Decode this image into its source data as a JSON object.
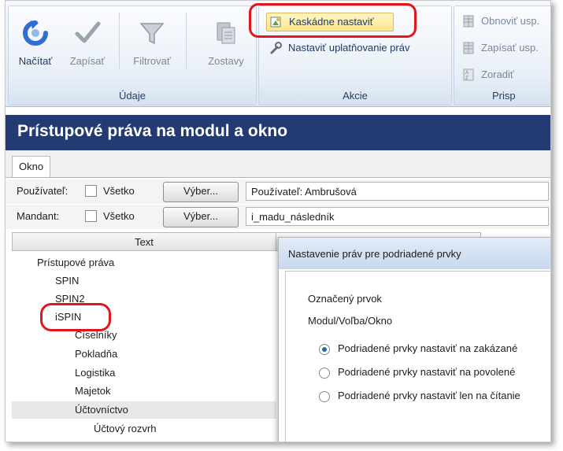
{
  "ribbon": {
    "data_group": {
      "label": "Údaje",
      "load": "Načítať",
      "save": "Zapísať",
      "filter": "Filtrovať",
      "reports": "Zostavy"
    },
    "actions_group": {
      "label": "Akcie",
      "cascade": "Kaskádne nastaviť",
      "apply_rights": "Nastaviť uplatňovanie práv"
    },
    "pris_group": {
      "label": "Prisp",
      "restore": "Obnoviť usp.",
      "write": "Zapísať usp.",
      "sort": "Zoradiť"
    }
  },
  "title": "Prístupové práva na modul a okno",
  "tabs": [
    "Okno"
  ],
  "filters": {
    "user": {
      "label": "Používateľ:",
      "all_label": "Všetko",
      "select_label": "Výber...",
      "value": "Používateľ: Ambrušová"
    },
    "mandant": {
      "label": "Mandant:",
      "all_label": "Všetko",
      "select_label": "Výber...",
      "value": "i_madu_následník"
    }
  },
  "tree": {
    "header": "Text",
    "nodes": [
      {
        "label": "Prístupové práva"
      },
      {
        "label": "SPIN"
      },
      {
        "label": "SPIN2"
      },
      {
        "label": "iSPIN"
      },
      {
        "label": "Číselníky"
      },
      {
        "label": "Pokladňa"
      },
      {
        "label": "Logistika"
      },
      {
        "label": "Majetok"
      },
      {
        "label": "Účtovníctvo"
      },
      {
        "label": "Účtový rozvrh"
      }
    ]
  },
  "dialog": {
    "title": "Nastavenie práv pre podriadené prvky",
    "marked_label": "Označený prvok",
    "marked_value": "Modul/Voľba/Okno",
    "options": [
      {
        "label": "Podriadené prvky nastaviť na zakázané",
        "selected": true
      },
      {
        "label": "Podriadené prvky nastaviť na povolené",
        "selected": false
      },
      {
        "label": "Podriadené prvky nastaviť len na čítanie",
        "selected": false
      }
    ]
  },
  "colors": {
    "title_bar": "#233a73",
    "highlight": "#e0161b",
    "ribbon_text": "#1e3a66"
  }
}
